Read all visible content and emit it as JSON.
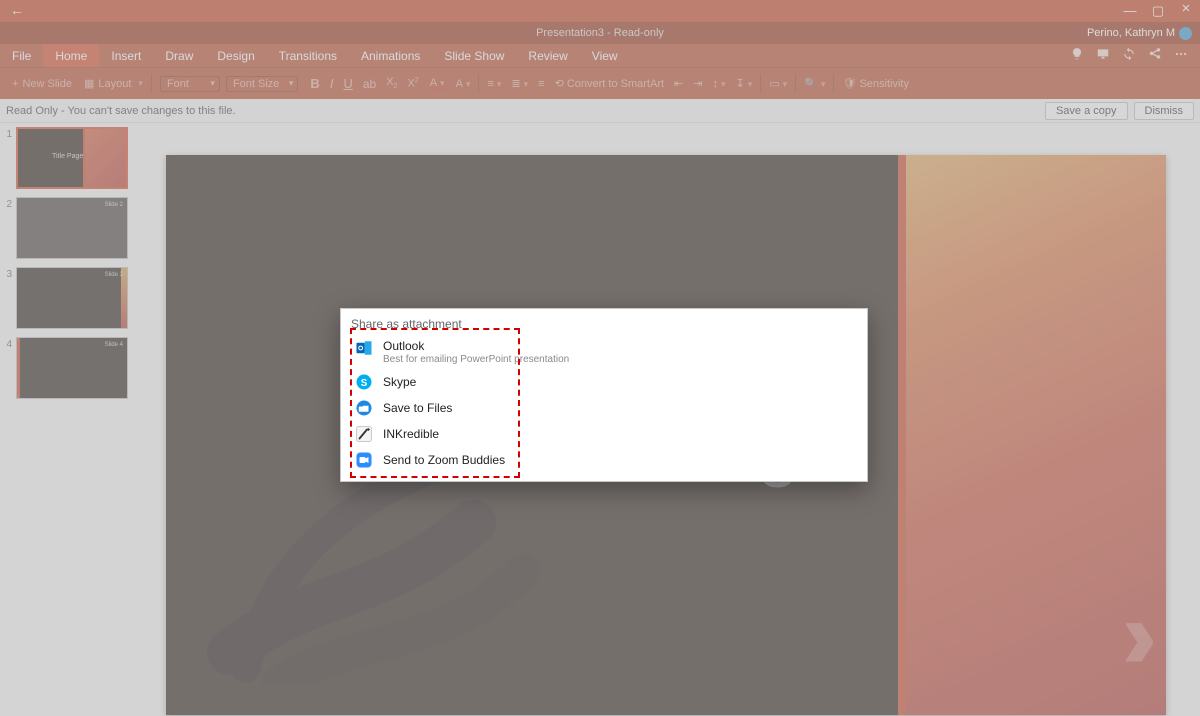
{
  "titlebar": {
    "doc_title": "Presentation3 - Read-only",
    "user_name": "Perino, Kathryn M"
  },
  "tabs": {
    "file": "File",
    "home": "Home",
    "insert": "Insert",
    "draw": "Draw",
    "design": "Design",
    "transitions": "Transitions",
    "animations": "Animations",
    "slideshow": "Slide Show",
    "review": "Review",
    "view": "View"
  },
  "toolbar": {
    "new_slide": "New Slide",
    "layout": "Layout",
    "font": "Font",
    "font_size": "Font Size",
    "convert_smartart": "Convert to SmartArt",
    "sensitivity": "Sensitivity"
  },
  "msgbar": {
    "text": "Read Only - You can't save changes to this file.",
    "save_copy": "Save a copy",
    "dismiss": "Dismiss"
  },
  "thumbs": {
    "n1": "1",
    "n2": "2",
    "n3": "3",
    "n4": "4",
    "title_page": "Title Page",
    "t2": "Slide 2",
    "t3": "Slide 3",
    "t4": "Slide 4"
  },
  "slide": {
    "big_title": "Title Page",
    "chevrons": "››››"
  },
  "share": {
    "heading": "Share as attachment",
    "outlook": "Outlook",
    "outlook_sub": "Best for emailing PowerPoint presentation",
    "skype": "Skype",
    "save_files": "Save to Files",
    "inkredible": "INKredible",
    "zoom": "Send to Zoom Buddies"
  }
}
